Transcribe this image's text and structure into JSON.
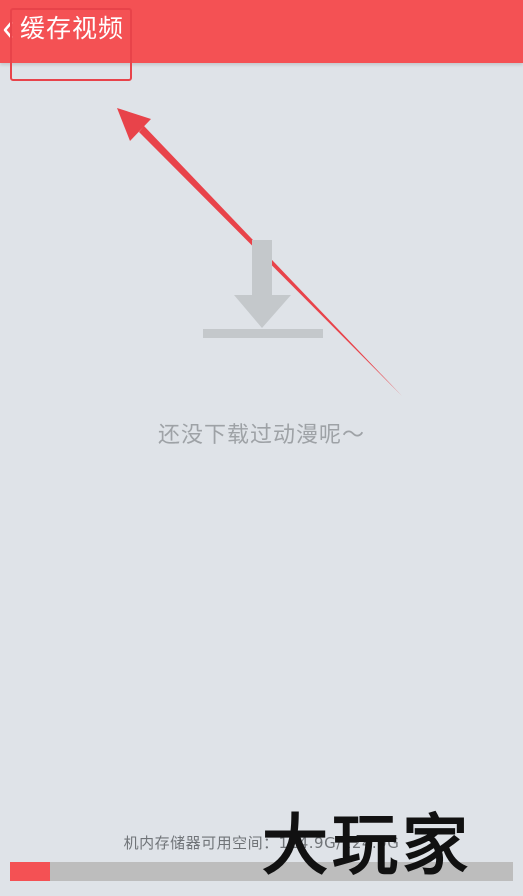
{
  "header": {
    "title": "缓存视频",
    "back_icon": "chevron-left-icon",
    "background_color": "#f45154"
  },
  "empty_state": {
    "icon": "download-icon",
    "message": "还没下载过动漫呢～"
  },
  "storage": {
    "label": "机内存储器可用空间：114.9G/124.9G",
    "used_fraction": 0.08,
    "fill_color": "#f45154"
  },
  "watermark": {
    "text": "大玩家"
  },
  "annotation": {
    "color": "#e8434a"
  }
}
